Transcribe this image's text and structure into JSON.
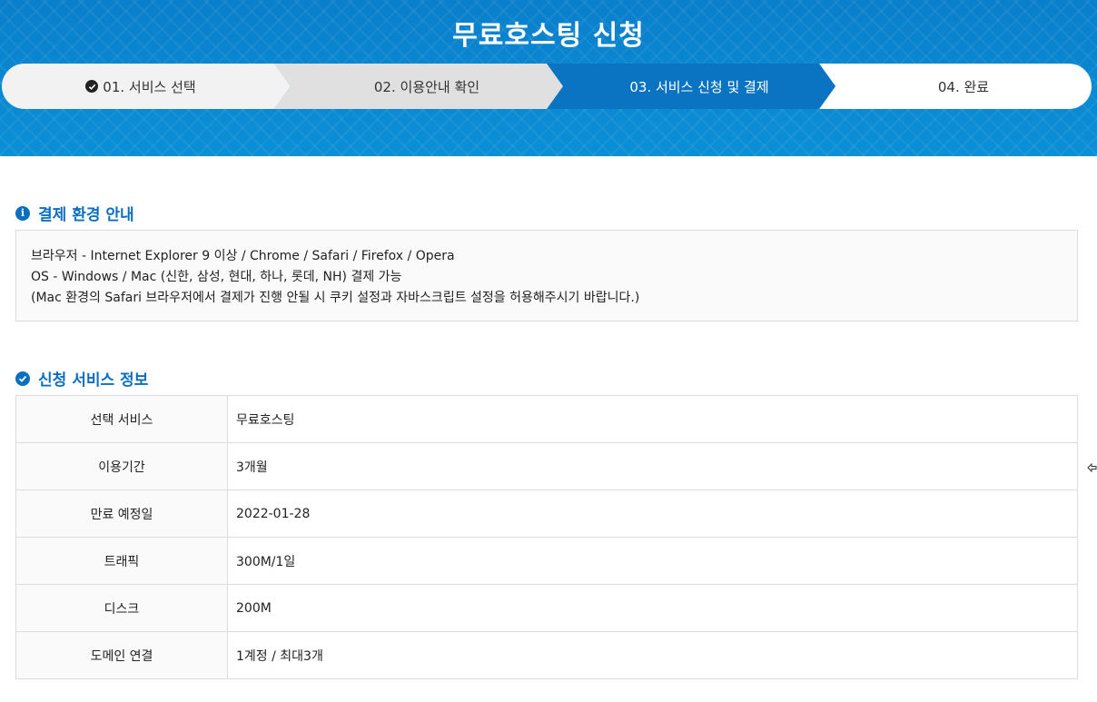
{
  "banner": {
    "title": "무료호스팅 신청"
  },
  "steps": [
    {
      "label": "01. 서비스 선택",
      "state": "completed"
    },
    {
      "label": "02. 이용안내 확인",
      "state": "completed"
    },
    {
      "label": "03. 서비스 신청 및 결제",
      "state": "current"
    },
    {
      "label": "04. 완료",
      "state": "pending"
    }
  ],
  "payment_env": {
    "title": "결제 환경 안내",
    "icon": "info-icon",
    "lines": [
      "브라우저 - Internet Explorer 9 이상 / Chrome / Safari / Firefox / Opera",
      "OS - Windows / Mac (신한, 삼성, 현대, 하나, 롯데, NH) 결제 가능",
      "(Mac 환경의 Safari 브라우저에서 결제가 진행 안될 시 쿠키 설정과 자바스크립트 설정을 허용해주시기 바랍니다.)"
    ]
  },
  "service_info": {
    "title": "신청 서비스 정보",
    "icon": "check-circle-icon",
    "rows": [
      {
        "label": "선택 서비스",
        "value": "무료호스팅"
      },
      {
        "label": "이용기간",
        "value": "3개월"
      },
      {
        "label": "만료 예정일",
        "value": "2022-01-28"
      },
      {
        "label": "트래픽",
        "value": "300M/1일"
      },
      {
        "label": "디스크",
        "value": "200M"
      },
      {
        "label": "도메인 연결",
        "value": "1계정 / 최대3개"
      }
    ]
  },
  "colors": {
    "banner": "#0a86cf",
    "current_step": "#0a73c2",
    "section_title": "#0a6fc0"
  }
}
